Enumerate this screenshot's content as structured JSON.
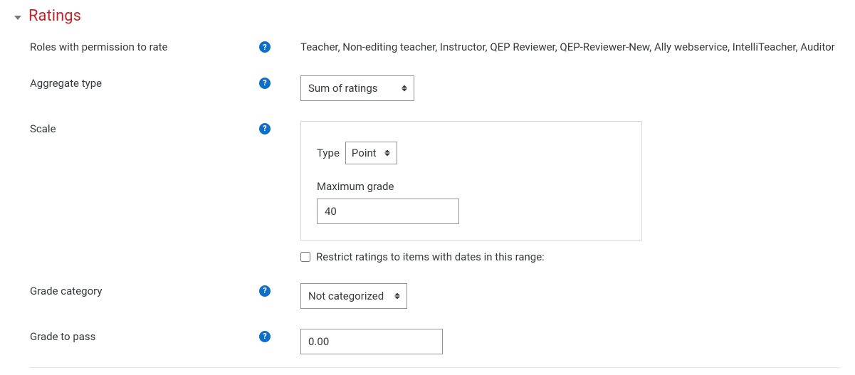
{
  "section": {
    "title": "Ratings"
  },
  "roles": {
    "label": "Roles with permission to rate",
    "value": "Teacher, Non-editing teacher, Instructor, QEP Reviewer, QEP-Reviewer-New, Ally webservice, IntelliTeacher, Auditor"
  },
  "aggregate": {
    "label": "Aggregate type",
    "selected": "Sum of ratings"
  },
  "scale": {
    "label": "Scale",
    "type_label": "Type",
    "type_selected": "Point",
    "max_label": "Maximum grade",
    "max_value": "40"
  },
  "restrict": {
    "label": "Restrict ratings to items with dates in this range:",
    "checked": false
  },
  "grade_category": {
    "label": "Grade category",
    "selected": "Not categorized"
  },
  "grade_to_pass": {
    "label": "Grade to pass",
    "value": "0.00"
  }
}
